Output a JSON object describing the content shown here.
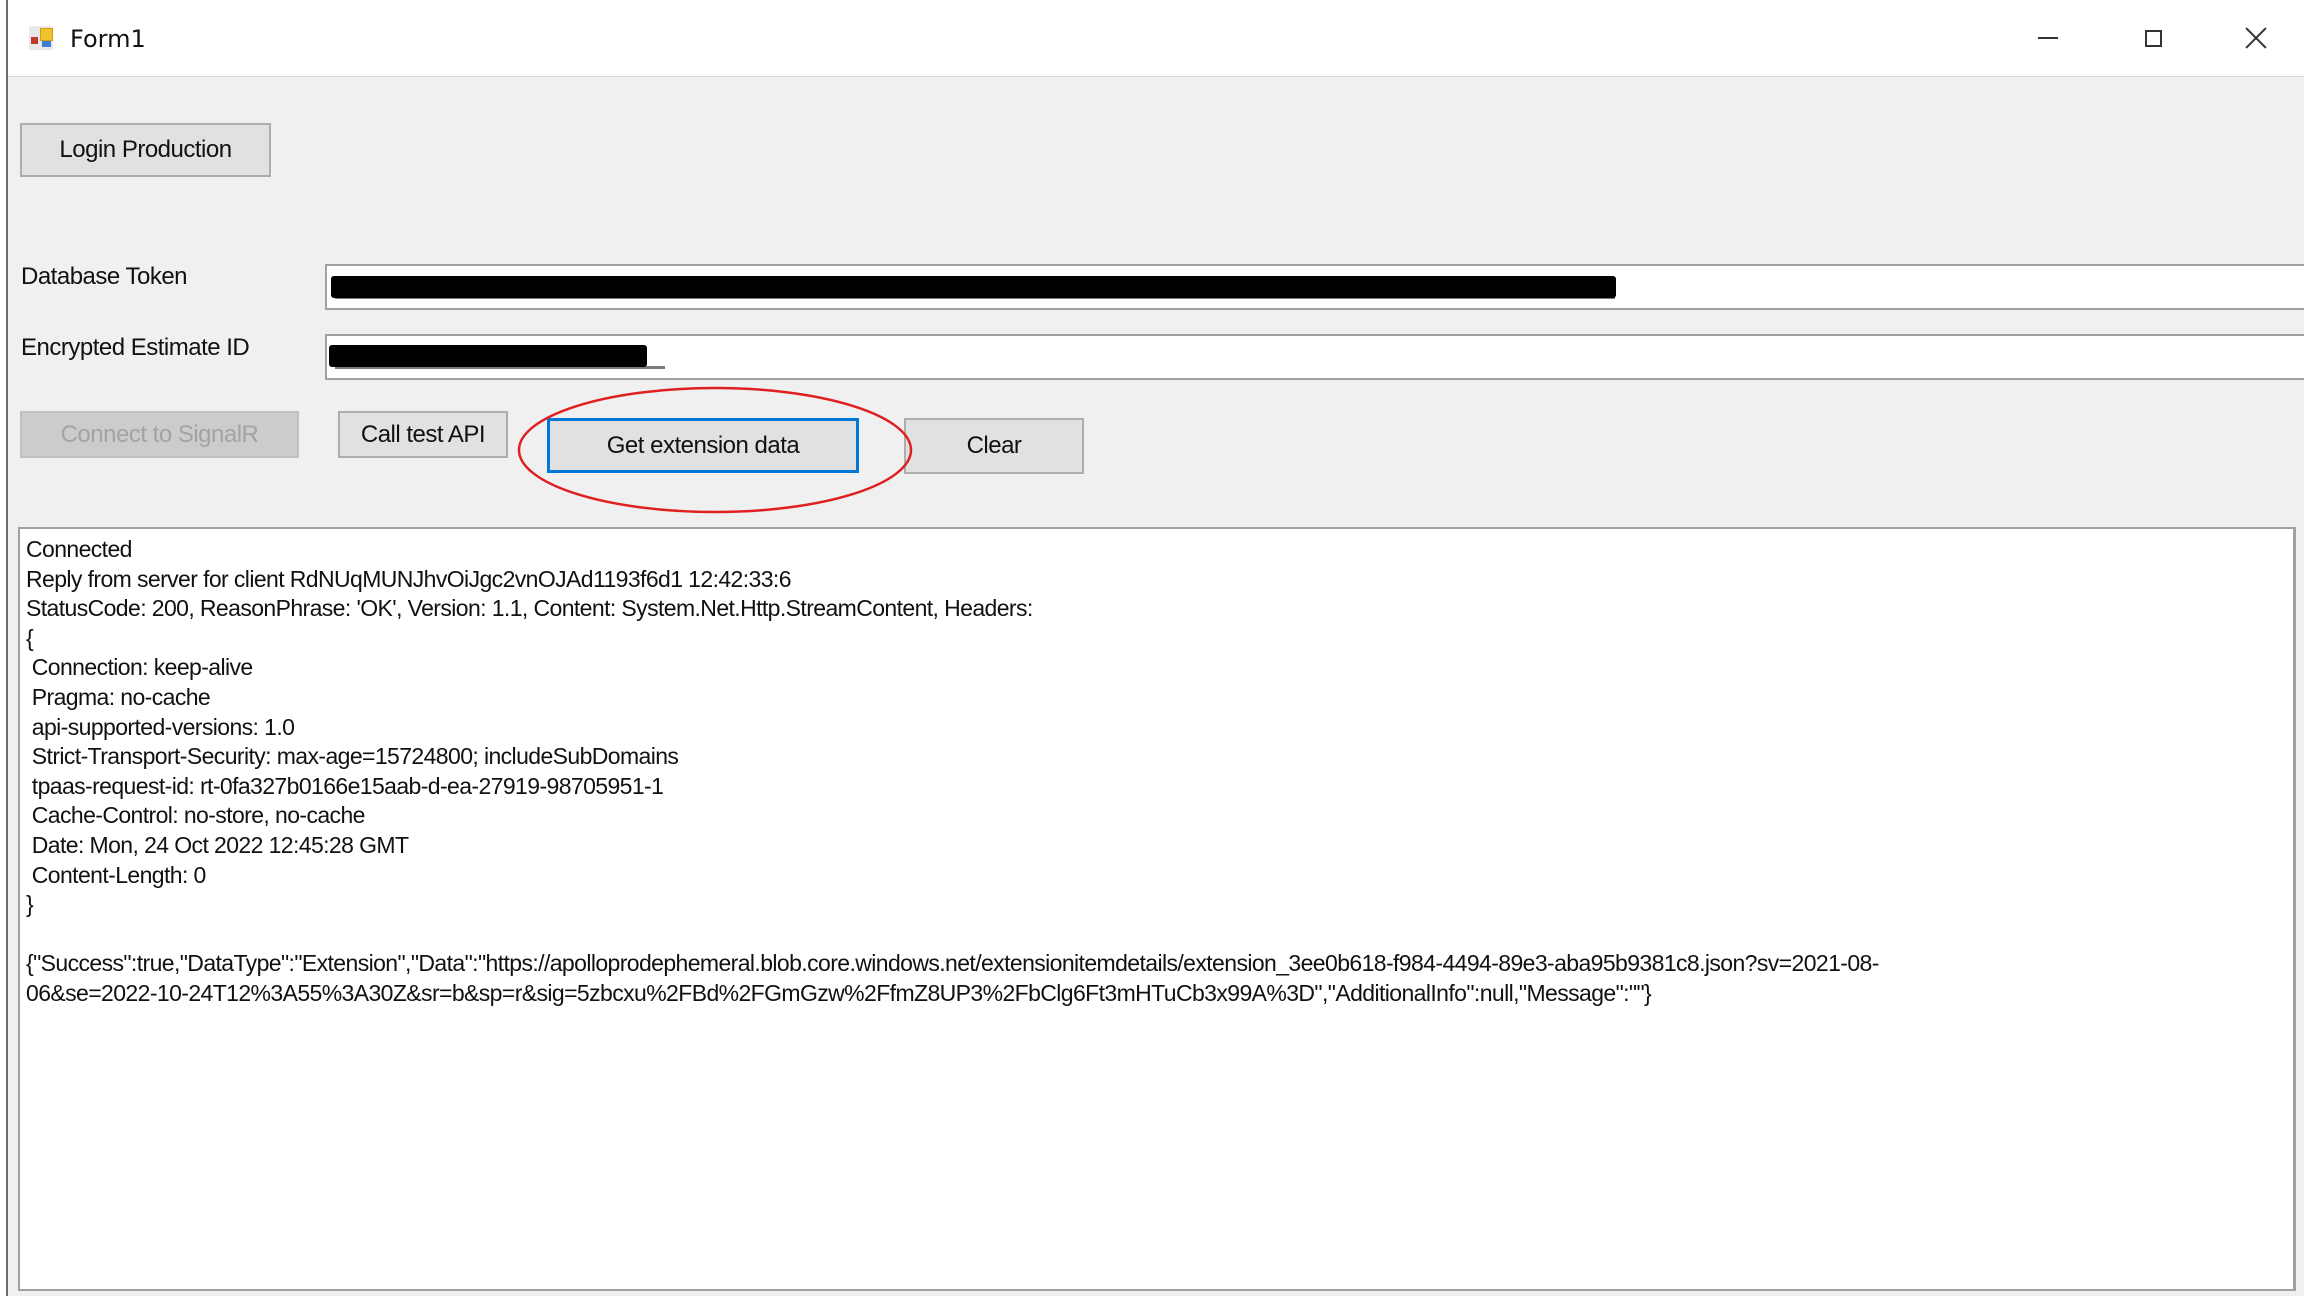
{
  "window": {
    "title": "Form1",
    "icon": "winforms-app-icon",
    "controls": {
      "minimize": "minimize-icon",
      "maximize": "maximize-icon",
      "close": "close-icon"
    }
  },
  "buttons": {
    "login": "Login Production",
    "connect": "Connect to SignalR",
    "call_test": "Call test API",
    "get_extension": "Get extension data",
    "clear": "Clear"
  },
  "fields": {
    "token_label": "Database Token",
    "token_value": "[redacted]",
    "estimate_label": "Encrypted Estimate ID",
    "estimate_value": "[redacted]"
  },
  "annotation": {
    "highlight": "Get extension data",
    "color": "#e02020"
  },
  "accent_color": "#0078d7",
  "output": {
    "lines": [
      "Connected",
      "Reply from server for client RdNUqMUNJhvOiJgc2vnOJAd1193f6d1 12:42:33:6",
      "StatusCode: 200, ReasonPhrase: 'OK', Version: 1.1, Content: System.Net.Http.StreamContent, Headers:",
      "{",
      "  Connection: keep-alive",
      "  Pragma: no-cache",
      "  api-supported-versions: 1.0",
      "  Strict-Transport-Security: max-age=15724800; includeSubDomains",
      "  tpaas-request-id: rt-0fa327b0166e15aab-d-ea-27919-98705951-1",
      "  Cache-Control: no-store, no-cache",
      "  Date: Mon, 24 Oct 2022 12:45:28 GMT",
      "  Content-Length: 0",
      "}",
      "",
      "{\"Success\":true,\"DataType\":\"Extension\",\"Data\":\"https://apolloprodephemeral.blob.core.windows.net/extensionitemdetails/extension_3ee0b618-f984-4494-89e3-aba95b9381c8.json?sv=2021-08-",
      "06&se=2022-10-24T12%3A55%3A30Z&sr=b&sp=r&sig=5zbcxu%2FBd%2FGmGzw%2FfmZ8UP3%2FbClg6Ft3mHTuCb3x99A%3D\",\"AdditionalInfo\":null,\"Message\":\"\"}"
    ]
  }
}
